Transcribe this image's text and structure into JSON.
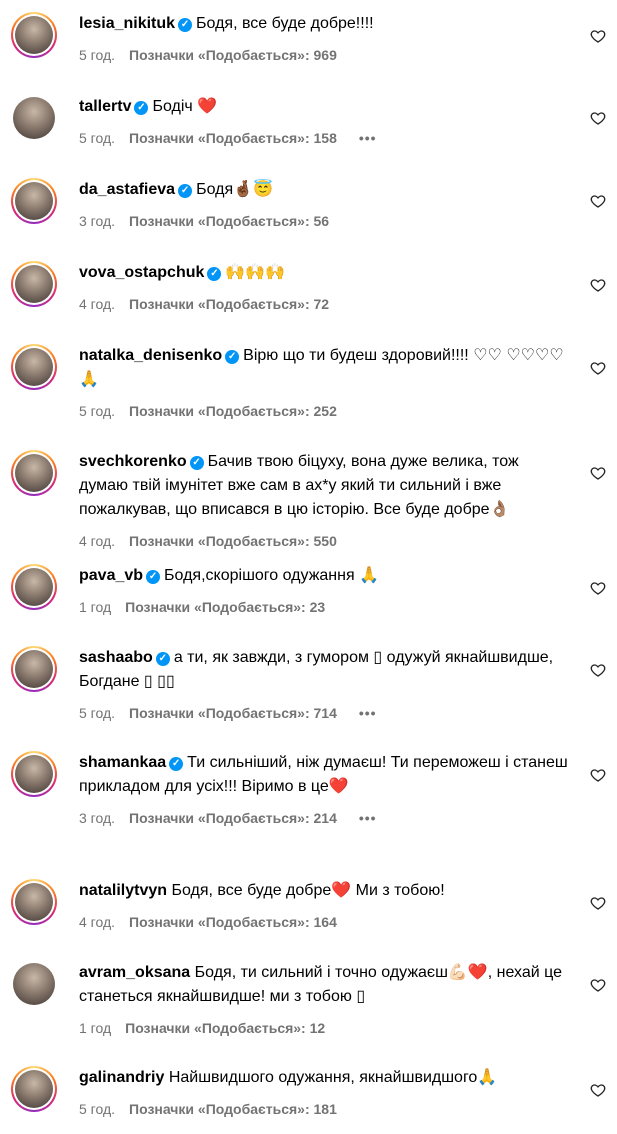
{
  "labels": {
    "likes_prefix": "Позначки «Подобається»: "
  },
  "comments": [
    {
      "username": "lesia_nikituk",
      "verified": true,
      "text": "Бодя, все буде добре!!!!",
      "time": "5 год.",
      "likes": "969",
      "more": false,
      "story": true
    },
    {
      "username": "tallertv",
      "verified": true,
      "text": "Бодіч ❤️",
      "time": "5 год.",
      "likes": "158",
      "more": true,
      "story": false
    },
    {
      "username": "da_astafieva",
      "verified": true,
      "text": "Бодя🤞🏾😇",
      "time": "3 год.",
      "likes": "56",
      "more": false,
      "story": true
    },
    {
      "username": "vova_ostapchuk",
      "verified": true,
      "text": "🙌🙌🙌",
      "time": "4 год.",
      "likes": "72",
      "more": false,
      "story": true
    },
    {
      "username": "natalka_denisenko",
      "verified": true,
      "text": "Вірю що ти будеш здоровий!!!! ♡♡ ♡♡♡♡🙏",
      "time": "5 год.",
      "likes": "252",
      "more": false,
      "story": true
    },
    {
      "username": "svechkorenko",
      "verified": true,
      "text": "Бачив твою біцуху, вона дуже велика, тож думаю твій імунітет вже сам в ах*у який ти сильний і вже пожалкував, що вписався в цю історію. Все буде добре👌🏽",
      "time": "4 год.",
      "likes": "550",
      "more": false,
      "story": true
    },
    {
      "username": "pava_vb",
      "verified": true,
      "text": "Бодя,скорішого одужання 🙏",
      "time": "1 год",
      "likes": "23",
      "more": false,
      "story": true
    },
    {
      "username": "sashaabo",
      "verified": true,
      "text": "а ти, як завжди, з гумором ▯ одужуй якнайшвидше, Богдане ▯ ▯▯",
      "time": "5 год.",
      "likes": "714",
      "more": true,
      "story": true
    },
    {
      "username": "shamankaa",
      "verified": true,
      "text": "Ти сильніший, ніж думаєш! Ти переможеш і станеш прикладом для усіх!!! Віримо в це❤️",
      "time": "3 год.",
      "likes": "214",
      "more": true,
      "story": true
    },
    {
      "username": "natalilytvyn",
      "verified": false,
      "text": "Бодя, все буде добре❤️ Ми з тобою!",
      "time": "4 год.",
      "likes": "164",
      "more": false,
      "story": true
    },
    {
      "username": "avram_oksana",
      "verified": false,
      "text": "Бодя, ти сильний і точно одужаєш💪🏻❤️, нехай це станеться якнайшвидше! ми з тобою ▯",
      "time": "1 год",
      "likes": "12",
      "more": false,
      "story": false
    },
    {
      "username": "galinandriy",
      "verified": false,
      "text": "Найшвидшого одужання, якнайшвидшого🙏",
      "time": "5 год.",
      "likes": "181",
      "more": false,
      "story": true
    }
  ]
}
